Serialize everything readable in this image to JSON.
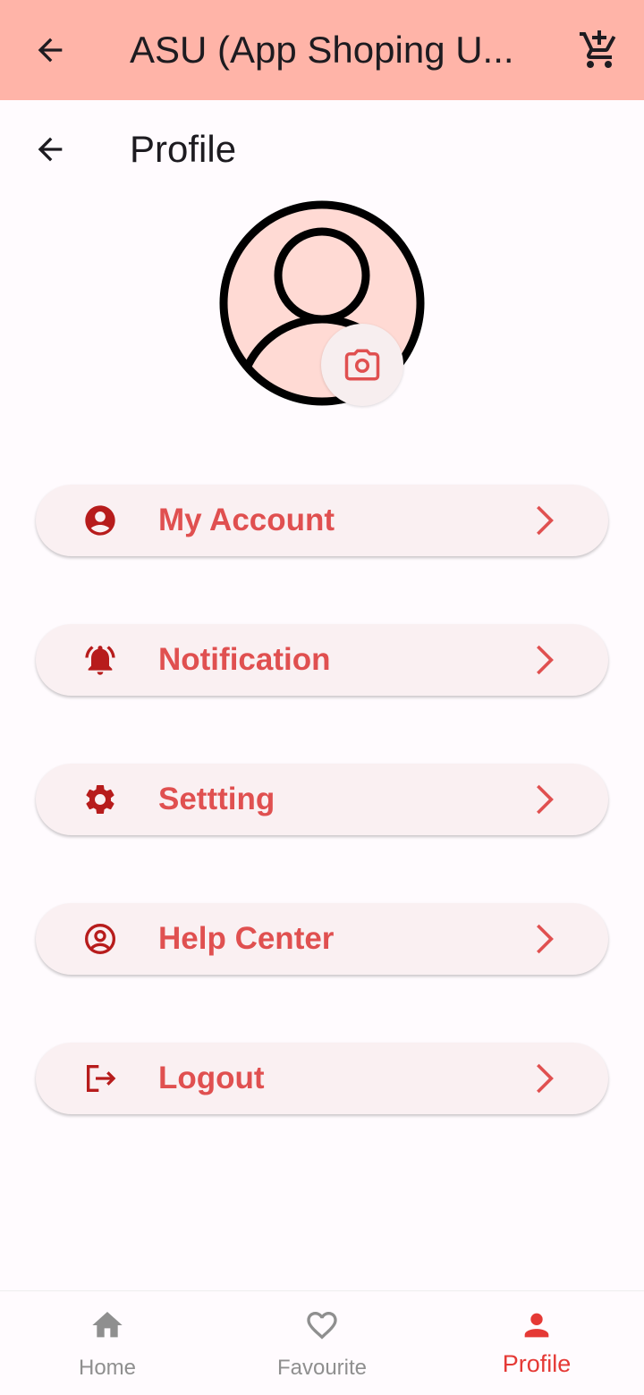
{
  "appbar": {
    "title": "ASU (App Shoping U...",
    "back_icon": "arrow-back-icon",
    "cart_icon": "add-shopping-cart-icon"
  },
  "page": {
    "title": "Profile",
    "back_icon": "arrow-back-icon"
  },
  "avatar": {
    "icon": "person-outline-icon",
    "camera_icon": "camera-icon"
  },
  "menu": [
    {
      "label": "My Account",
      "icon": "account-circle-icon"
    },
    {
      "label": "Notification",
      "icon": "notification-bell-icon"
    },
    {
      "label": "Settting",
      "icon": "gear-icon"
    },
    {
      "label": "Help Center",
      "icon": "help-center-icon"
    },
    {
      "label": "Logout",
      "icon": "logout-icon"
    }
  ],
  "bottom_nav": [
    {
      "label": "Home",
      "icon": "home-icon",
      "active": false
    },
    {
      "label": "Favourite",
      "icon": "heart-outline-icon",
      "active": false
    },
    {
      "label": "Profile",
      "icon": "person-icon",
      "active": true
    }
  ],
  "colors": {
    "appbar_bg": "#ffb4a8",
    "accent": "#e05050",
    "icon_dark_red": "#b71c1c",
    "nav_active": "#e53935",
    "nav_inactive": "#8f8f8f",
    "item_bg": "#faf0f2"
  }
}
